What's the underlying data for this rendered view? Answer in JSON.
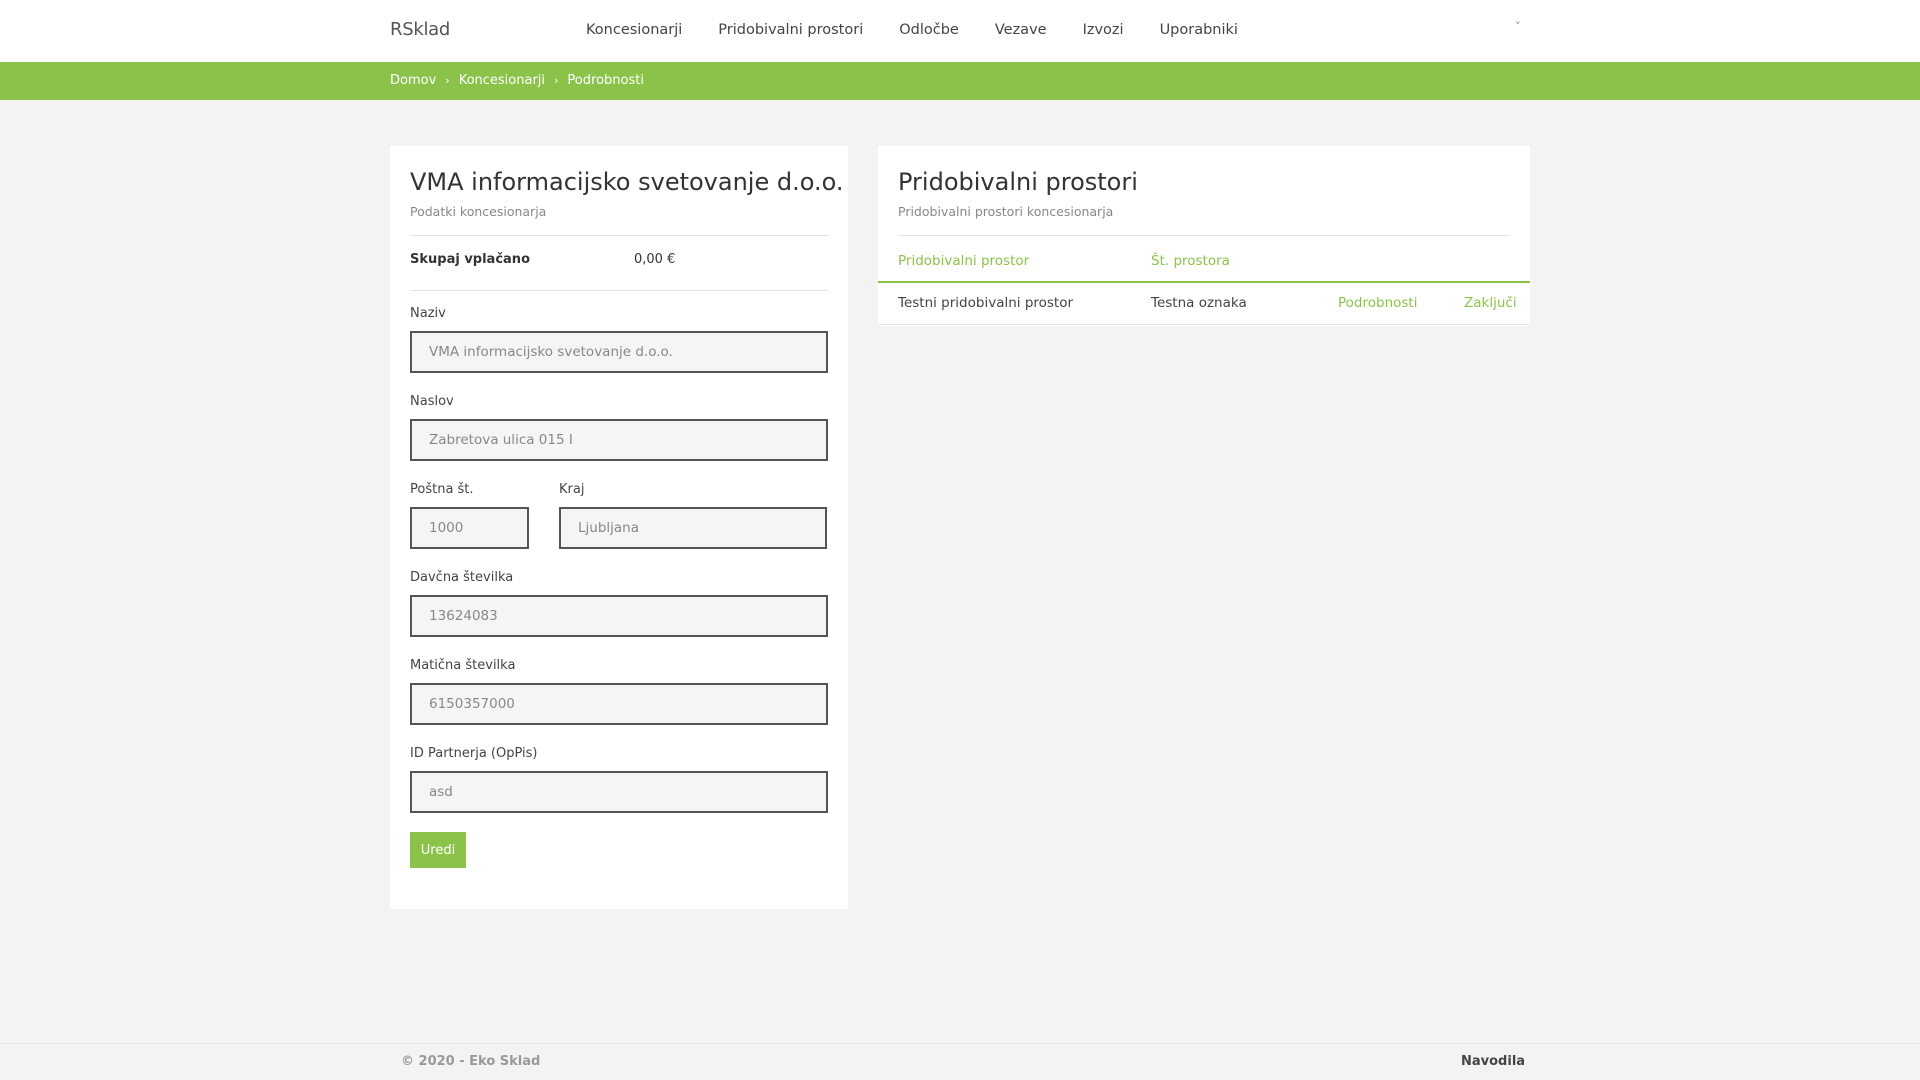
{
  "header": {
    "brand": "RSklad",
    "nav": [
      "Koncesionarji",
      "Pridobivalni prostori",
      "Odločbe",
      "Vezave",
      "Izvozi",
      "Uporabniki"
    ],
    "user_caret": "˅"
  },
  "breadcrumb": {
    "items": [
      "Domov",
      "Koncesionarji",
      "Podrobnosti"
    ],
    "separator": "›"
  },
  "concessionaire": {
    "title": "VMA informacijsko svetovanje d.o.o.",
    "subtitle": "Podatki koncesionarja",
    "total_label": "Skupaj vplačano",
    "total_value": "0,00 €",
    "fields": {
      "naziv": {
        "label": "Naziv",
        "value": "VMA informacijsko svetovanje d.o.o."
      },
      "naslov": {
        "label": "Naslov",
        "value": "Zabretova ulica 015 I"
      },
      "postna": {
        "label": "Poštna št.",
        "value": "1000"
      },
      "kraj": {
        "label": "Kraj",
        "value": "Ljubljana"
      },
      "davcna": {
        "label": "Davčna številka",
        "value": "13624083"
      },
      "maticna": {
        "label": "Matična številka",
        "value": "6150357000"
      },
      "partner": {
        "label": "ID Partnerja (OpPis)",
        "value": "asd"
      }
    },
    "edit_button": "Uredi"
  },
  "premises": {
    "title": "Pridobivalni prostori",
    "subtitle": "Pridobivalni prostori koncesionarja",
    "columns": [
      "Pridobivalni prostor",
      "Št. prostora"
    ],
    "rows": [
      {
        "name": "Testni pridobivalni prostor",
        "number": "Testna oznaka",
        "details": "Podrobnosti",
        "close": "Zaključi"
      }
    ]
  },
  "footer": {
    "copyright": "© 2020 - Eko Sklad",
    "help": "Navodila"
  }
}
